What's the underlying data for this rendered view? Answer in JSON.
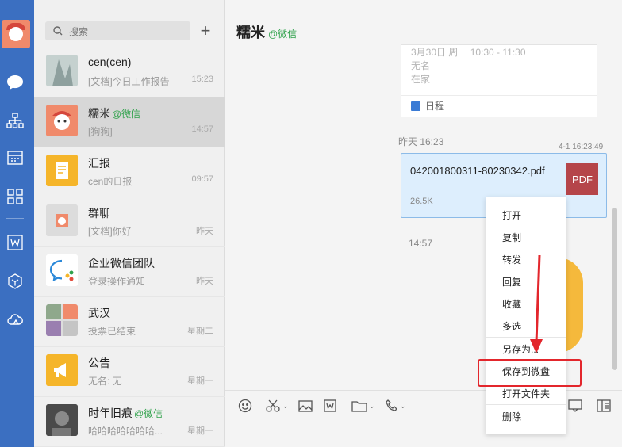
{
  "sidebar_icons": [
    "chat-icon",
    "org-icon",
    "calendar-icon",
    "apps-icon",
    "doc-icon",
    "box-icon",
    "cloud-icon"
  ],
  "search": {
    "placeholder": "搜索"
  },
  "chats": [
    {
      "name": "cen(cen)",
      "wechat_tag": "",
      "preview": "[文档]今日工作报告",
      "time": "15:23"
    },
    {
      "name": "糯米",
      "wechat_tag": "@微信",
      "preview": "[狗狗]",
      "time": "14:57"
    },
    {
      "name": "汇报",
      "wechat_tag": "",
      "preview": "cen的日报",
      "time": "09:57"
    },
    {
      "name": "群聊",
      "wechat_tag": "",
      "preview": "[文档]你好",
      "time": "昨天"
    },
    {
      "name": "企业微信团队",
      "wechat_tag": "",
      "preview": "登录操作通知",
      "time": "昨天"
    },
    {
      "name": "武汉",
      "wechat_tag": "",
      "preview": "投票已结束",
      "time": "星期二"
    },
    {
      "name": "公告",
      "wechat_tag": "",
      "preview": "无名: 无",
      "time": "星期一"
    },
    {
      "name": "时年旧痕",
      "wechat_tag": "@微信",
      "preview": "哈哈哈哈哈哈哈...",
      "time": "星期一"
    }
  ],
  "conversation": {
    "title": "糯米",
    "wechat_tag": "@微信",
    "schedule": {
      "time_line": "3月30日 周一 10:30 - 11:30",
      "line2": "无名",
      "line3": "在家",
      "footer": "日程"
    },
    "timestamp1": "昨天 16:23",
    "timestamp2": "4-1 16:23:49",
    "file": {
      "name": "042001800311-80230342.pdf",
      "size": "26.5K",
      "type_badge": "PDF"
    },
    "timestamp3": "14:57"
  },
  "context_menu": [
    "打开",
    "复制",
    "转发",
    "回复",
    "收藏",
    "多选",
    "另存为...",
    "保存到微盘",
    "打开文件夹",
    "删除"
  ],
  "highlight_color": "#e3262c",
  "accent_color": "#3b6fc1"
}
